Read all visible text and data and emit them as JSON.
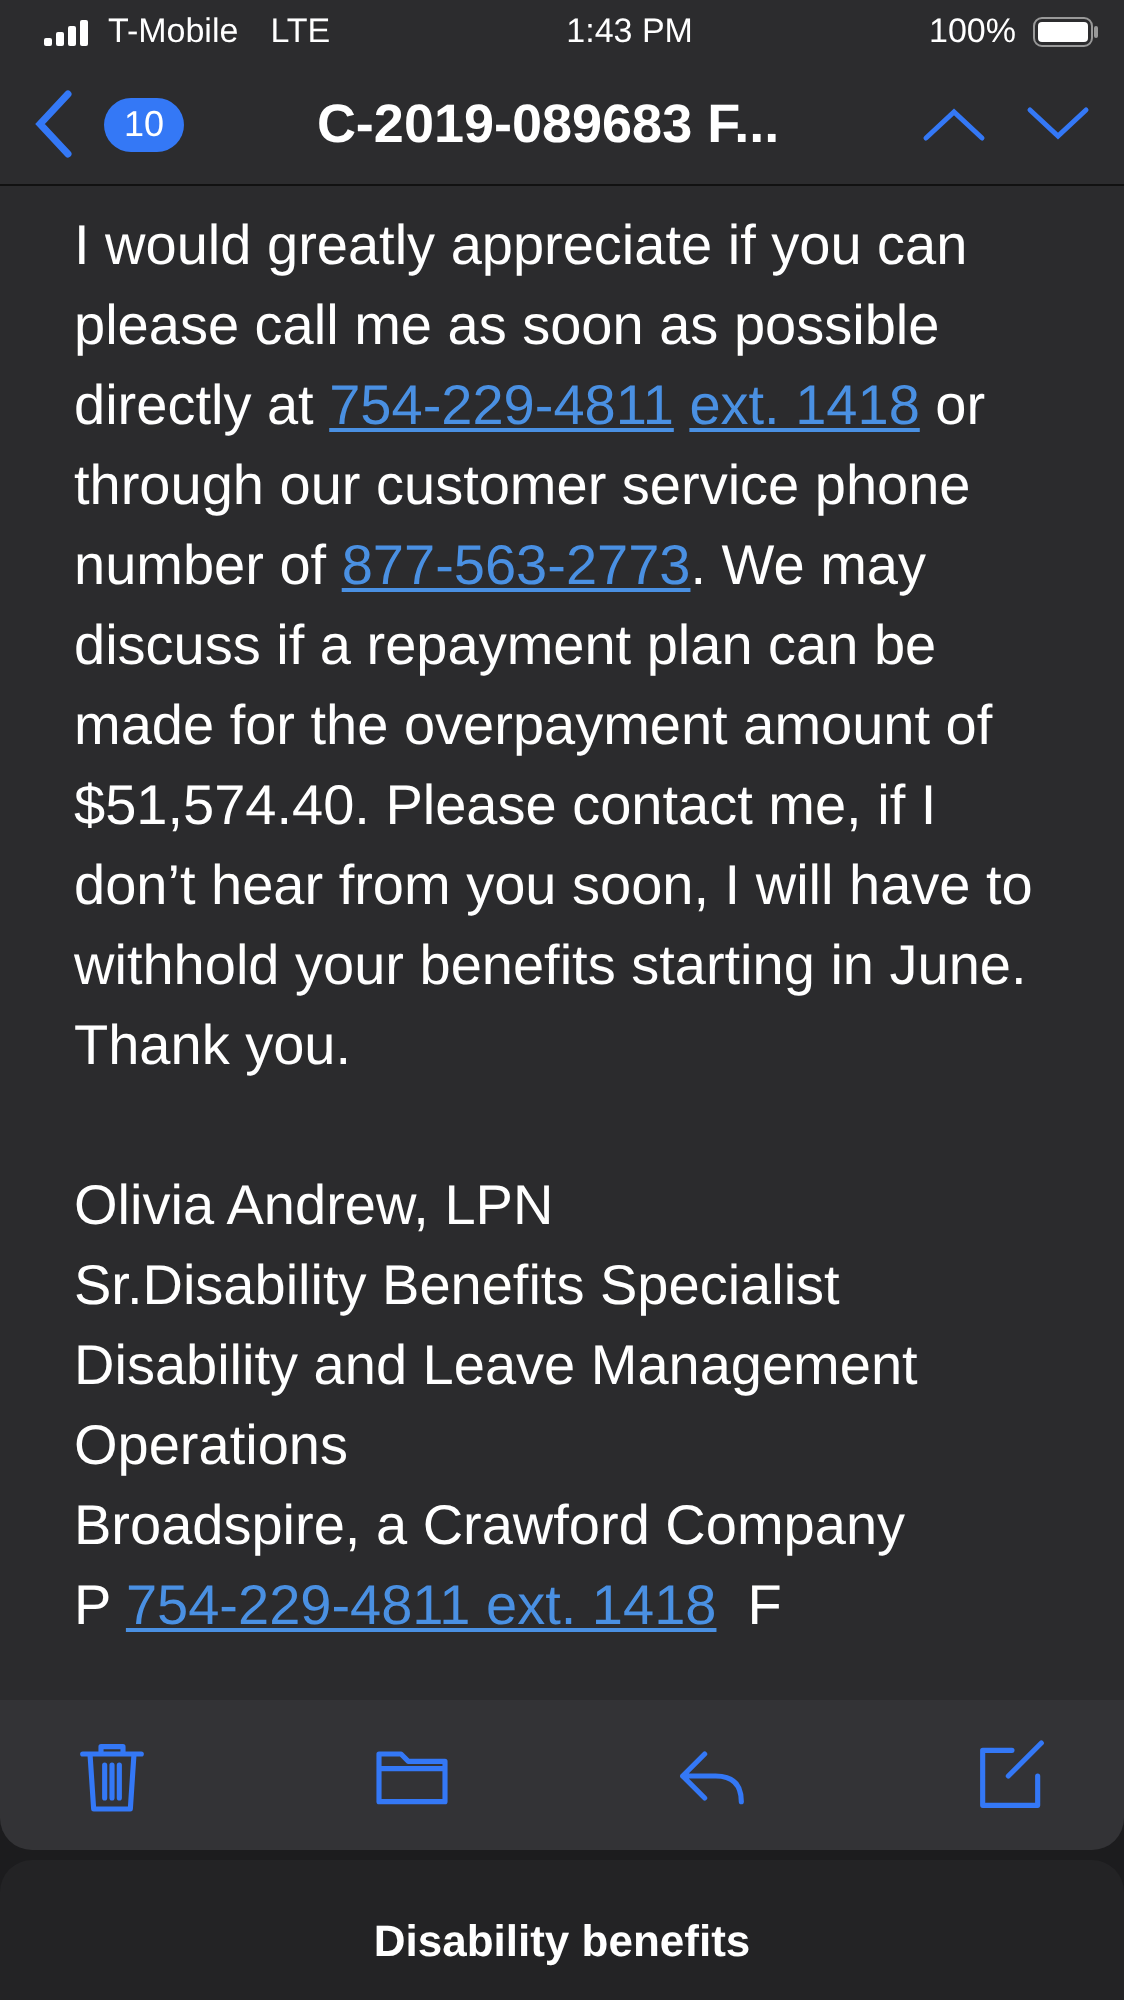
{
  "status_bar": {
    "carrier": "T-Mobile",
    "network": "LTE",
    "time": "1:43 PM",
    "battery": "100%"
  },
  "nav": {
    "badge": "10",
    "title": "C-2019-089683 F..."
  },
  "body": {
    "paragraph": [
      {
        "kind": "text",
        "text": "I would greatly appreciate if you can please call me as soon as possible directly at "
      },
      {
        "kind": "link",
        "text": "754-229-4811"
      },
      {
        "kind": "link",
        "text": "ext. 1418"
      },
      {
        "kind": "text",
        "text": " or through our customer service phone number of "
      },
      {
        "kind": "link",
        "text": "877-563-2773"
      },
      {
        "kind": "text",
        "text": ". We may discuss if a repayment plan can be made for the overpayment amount of $51,574.40. Please contact me, if I don’t hear from you soon, I will have to withhold your benefits starting in June. Thank you."
      }
    ],
    "signature": [
      "Olivia Andrew, LPN",
      "Sr.Disability Benefits Specialist",
      "Disability and Leave Management",
      "Operations",
      "Broadspire, a Crawford Company"
    ],
    "cut_line": [
      {
        "kind": "text",
        "text": "P"
      },
      {
        "kind": "link",
        "text": "754-229-4811 ext. 1418"
      },
      {
        "kind": "text",
        "text": "F"
      }
    ]
  },
  "draft": {
    "title": "Disability benefits"
  }
}
